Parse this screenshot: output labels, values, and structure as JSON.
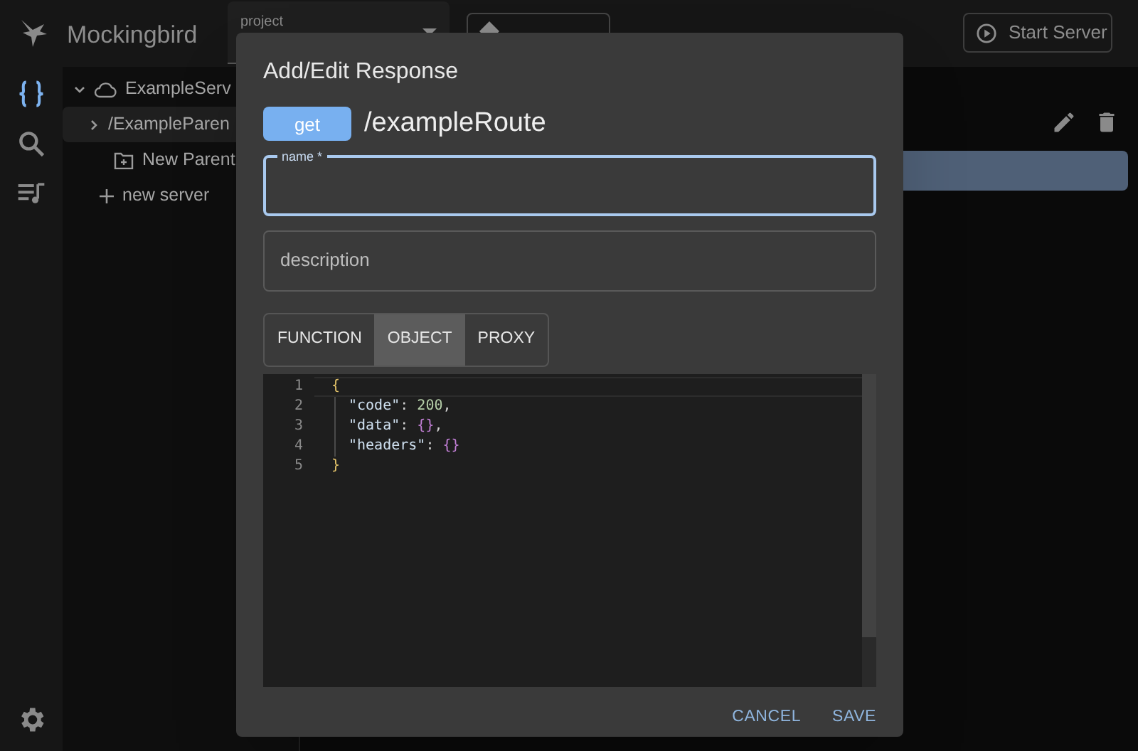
{
  "app": {
    "title": "Mockingbird"
  },
  "project_field": {
    "label": "project"
  },
  "toolbar": {
    "start_button": "Start Server"
  },
  "rail": [
    {
      "kind": "braces",
      "selected": true
    },
    {
      "kind": "search",
      "selected": false
    },
    {
      "kind": "playlist",
      "selected": false
    }
  ],
  "tree": [
    {
      "kind": "server",
      "label": "ExampleServ",
      "expanded": true,
      "selected": false,
      "children": [
        {
          "kind": "parent",
          "label": "/ExampleParen",
          "expanded": false,
          "selected": true
        },
        {
          "kind": "new-parent",
          "label": "New Parent",
          "selected": false
        }
      ]
    },
    {
      "kind": "new-server",
      "label": "new server",
      "selected": false
    }
  ],
  "dialog": {
    "title": "Add/Edit Response",
    "method": "get",
    "route": "/exampleRoute",
    "name_field": {
      "label": "name *",
      "focused": true
    },
    "description_field": {
      "placeholder": "description"
    },
    "modes": [
      {
        "label": "FUNCTION",
        "selected": false
      },
      {
        "label": "OBJECT",
        "selected": true
      },
      {
        "label": "PROXY",
        "selected": false
      }
    ],
    "editor": {
      "lines": [
        {
          "number": "1",
          "indented": false,
          "tokens": [
            {
              "kind": "brace",
              "text": "{"
            }
          ]
        },
        {
          "number": "2",
          "indented": true,
          "tokens": [
            {
              "kind": "key",
              "text": "\"code\""
            },
            {
              "kind": "plain",
              "text": ": "
            },
            {
              "kind": "number",
              "text": "200"
            },
            {
              "kind": "plain",
              "text": ","
            }
          ]
        },
        {
          "number": "3",
          "indented": true,
          "tokens": [
            {
              "kind": "key",
              "text": "\"data\""
            },
            {
              "kind": "plain",
              "text": ": "
            },
            {
              "kind": "object",
              "text": "{}"
            },
            {
              "kind": "plain",
              "text": ","
            }
          ]
        },
        {
          "number": "4",
          "indented": true,
          "tokens": [
            {
              "kind": "key",
              "text": "\"headers\""
            },
            {
              "kind": "plain",
              "text": ": "
            },
            {
              "kind": "object",
              "text": "{}"
            }
          ]
        },
        {
          "number": "5",
          "indented": false,
          "tokens": [
            {
              "kind": "brace",
              "text": "}"
            }
          ]
        }
      ]
    },
    "actions": [
      "CANCEL",
      "SAVE"
    ]
  }
}
